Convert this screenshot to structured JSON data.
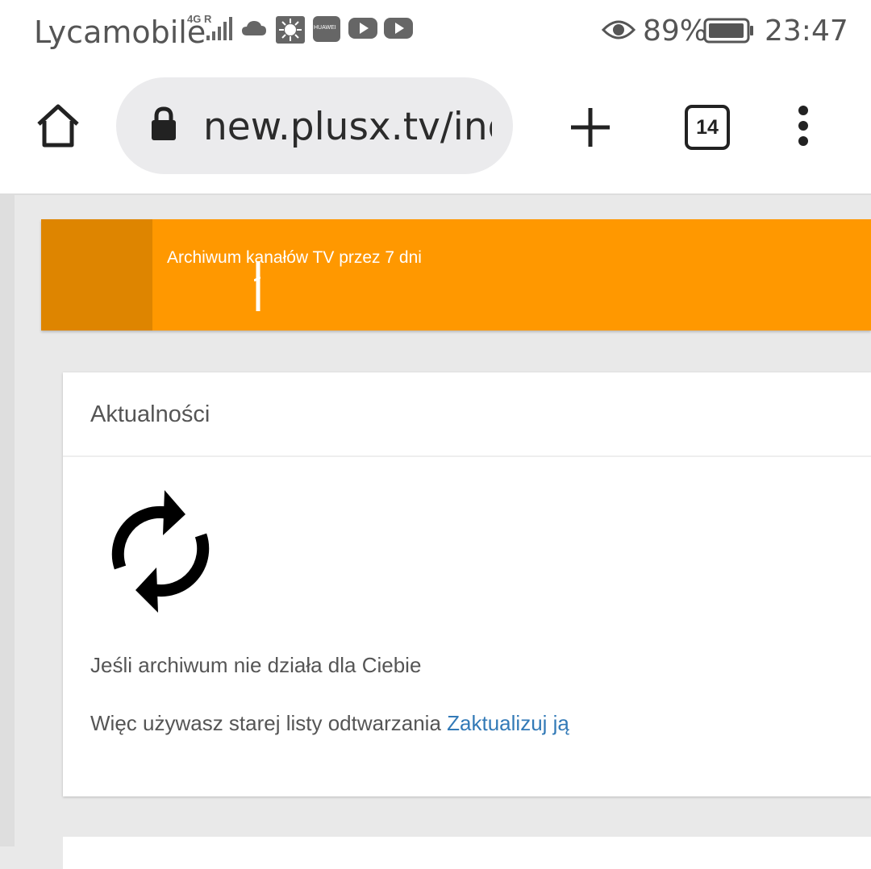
{
  "status_bar": {
    "carrier": "Lycamobile",
    "network_type": "4G",
    "network_extra": "R",
    "battery_percent": "89%",
    "time": "23:47",
    "icons": [
      "cloud-icon",
      "weather-icon",
      "huawei-appgallery-icon",
      "youtube-icon",
      "youtube-icon",
      "eye-comfort-icon",
      "battery-icon"
    ],
    "huawei_label": "HUAWEI"
  },
  "browser": {
    "url": "new.plusx.tv/index",
    "tab_count": "14"
  },
  "banner": {
    "text": "Archiwum kanałów TV przez 7 dni",
    "color": "#ff9800"
  },
  "news_card": {
    "title": "Aktualności",
    "line1": "Jeśli archiwum nie działa dla Ciebie",
    "line2_text": "Więc używasz starej listy odtwarzania",
    "line2_link": "Zaktualizuj ją",
    "link_color": "#337ab7"
  }
}
